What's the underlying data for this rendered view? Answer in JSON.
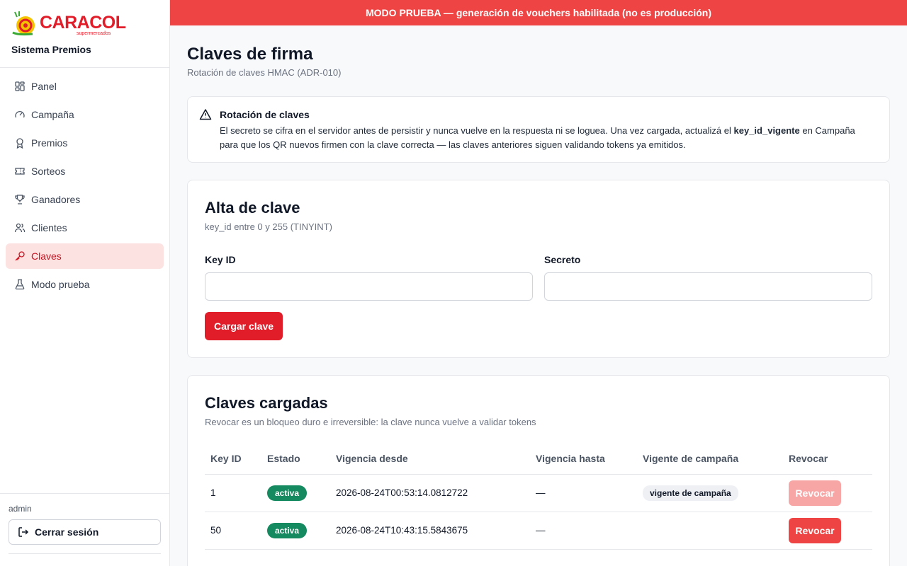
{
  "brand": {
    "logo_text": "CARACOL",
    "logo_sub": "supermercados",
    "app_name": "Sistema Premios",
    "accent": "#e11d2a"
  },
  "sidebar": {
    "items": [
      {
        "label": "Panel",
        "icon": "dashboard-icon"
      },
      {
        "label": "Campaña",
        "icon": "gauge-icon"
      },
      {
        "label": "Premios",
        "icon": "award-icon"
      },
      {
        "label": "Sorteos",
        "icon": "ticket-icon"
      },
      {
        "label": "Ganadores",
        "icon": "trophy-icon"
      },
      {
        "label": "Clientes",
        "icon": "users-icon"
      },
      {
        "label": "Claves",
        "icon": "key-icon",
        "active": true
      },
      {
        "label": "Modo prueba",
        "icon": "flask-icon"
      }
    ],
    "user": "admin",
    "logout_label": "Cerrar sesión"
  },
  "banner": {
    "text": "MODO PRUEBA — generación de vouchers habilitada (no es producción)",
    "color": "#ef4444"
  },
  "page": {
    "title": "Claves de firma",
    "subtitle": "Rotación de claves HMAC (ADR-010)"
  },
  "alert": {
    "title": "Rotación de claves",
    "body_part1": "El secreto se cifra en el servidor antes de persistir y nunca vuelve en la respuesta ni se loguea. Una vez cargada, actualizá el ",
    "body_bold": "key_id_vigente",
    "body_part2": " en Campaña para que los QR nuevos firmen con la clave correcta — las claves anteriores siguen validando tokens ya emitidos."
  },
  "form": {
    "title": "Alta de clave",
    "subtitle": "key_id entre 0 y 255 (TINYINT)",
    "key_id_label": "Key ID",
    "key_id_value": "",
    "secret_label": "Secreto",
    "secret_value": "",
    "submit_label": "Cargar clave"
  },
  "keys_table": {
    "title": "Claves cargadas",
    "subtitle": "Revocar es un bloqueo duro e irreversible: la clave nunca vuelve a validar tokens",
    "columns": [
      "Key ID",
      "Estado",
      "Vigencia desde",
      "Vigencia hasta",
      "Vigente de campaña",
      "Revocar"
    ],
    "rows": [
      {
        "key_id": "1",
        "estado": "activa",
        "desde": "2026-08-24T00:53:14.0812722",
        "hasta": "—",
        "vigente": "vigente de campaña",
        "revoke_label": "Revocar",
        "revoke_enabled": false
      },
      {
        "key_id": "50",
        "estado": "activa",
        "desde": "2026-08-24T10:43:15.5843675",
        "hasta": "—",
        "vigente": "",
        "revoke_label": "Revocar",
        "revoke_enabled": true
      }
    ]
  }
}
